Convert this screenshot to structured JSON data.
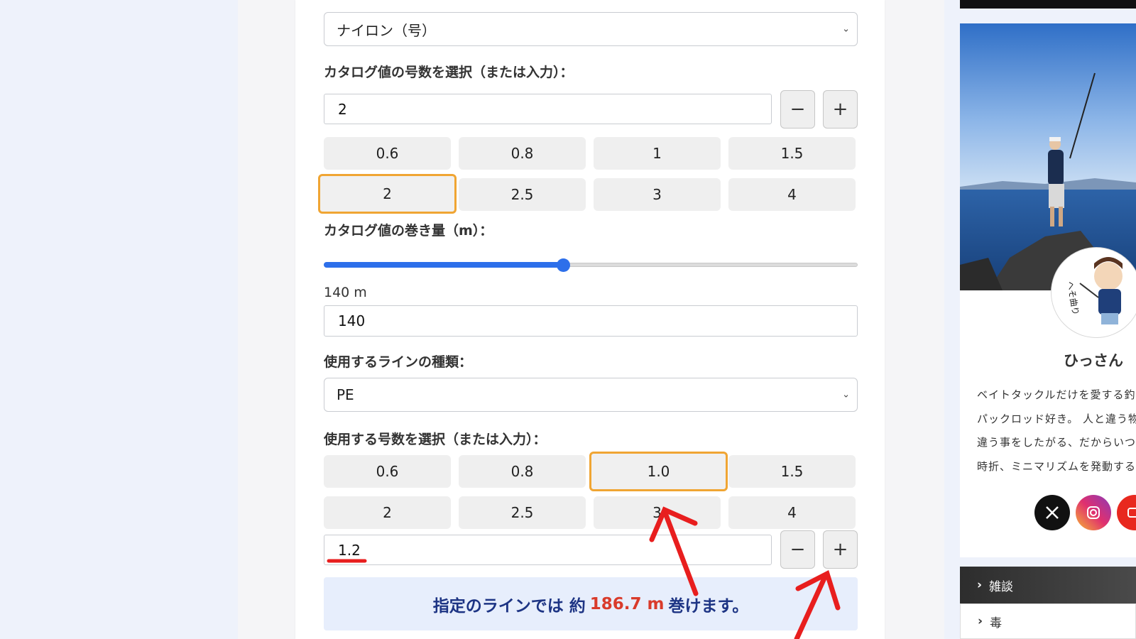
{
  "calculator": {
    "catalog_line_type": {
      "value": "ナイロン（号）"
    },
    "catalog_size": {
      "label": "カタログ値の号数を選択（または入力）：",
      "value": "2",
      "minus": "−",
      "plus": "+",
      "chips": [
        "0.6",
        "0.8",
        "1",
        "1.5",
        "2",
        "2.5",
        "3",
        "4"
      ],
      "selected_chip": "2"
    },
    "catalog_length": {
      "label": "カタログ値の巻き量（m）：",
      "slider_fraction": 0.45,
      "readout": "140 m",
      "value": "140"
    },
    "target_line_type": {
      "label": "使用するラインの種類：",
      "value": "PE"
    },
    "target_size": {
      "label": "使用する号数を選択（または入力）：",
      "chips": [
        "0.6",
        "0.8",
        "1.0",
        "1.5",
        "2",
        "2.5",
        "3",
        "4"
      ],
      "selected_chip": "1.0",
      "value": "1.2",
      "minus": "−",
      "plus": "+"
    },
    "result": {
      "prefix": "指定のラインでは 約",
      "amount": "186.7 m",
      "suffix": "巻けます。"
    }
  },
  "sidebar": {
    "avatar_caption": "へそ曲り",
    "name": "ひっさん",
    "bio_lines": [
      "ベイトタックルだけを愛する釣",
      "パックロッド好き。 人と違う物",
      "違う事をしたがる、だからいつ",
      "時折、ミニマリズムを発動する"
    ],
    "social": [
      "x-icon",
      "instagram-icon",
      "youtube-icon"
    ],
    "categories": [
      "雑談",
      "毒"
    ]
  },
  "colors": {
    "accent_blue": "#2d6fea",
    "selected_border": "#f0a533",
    "result_bg": "#e7eefc",
    "result_text": "#1d3484",
    "result_number": "#d93b2b",
    "annotation_red": "#e81e1e"
  }
}
